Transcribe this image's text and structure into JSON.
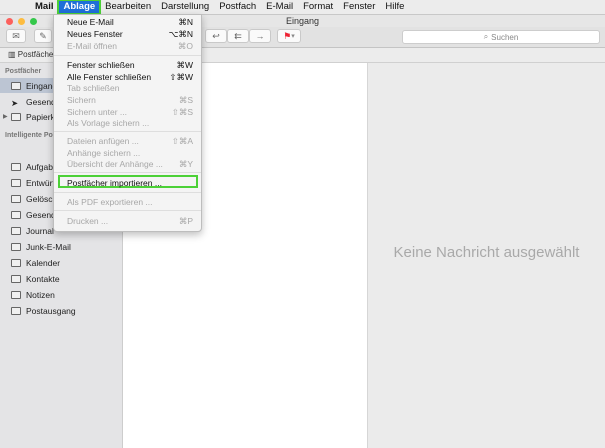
{
  "menubar": {
    "app": "Mail",
    "menus": [
      "Ablage",
      "Bearbeiten",
      "Darstellung",
      "Postfach",
      "E-Mail",
      "Format",
      "Fenster",
      "Hilfe"
    ]
  },
  "window": {
    "title": "Eingang"
  },
  "toolbar": {
    "search_placeholder": "Suchen"
  },
  "favorites": {
    "postfacher": "Postfächer"
  },
  "sidebar": {
    "section_mailboxes": "Postfächer",
    "mailboxes": [
      "Eingang",
      "Gesendet",
      "Papierkorb"
    ],
    "section_smart": "Intelligente Po",
    "folders": [
      "Aufgaben",
      "Entwürfe",
      "Gelöscht",
      "Gesendet",
      "Journal",
      "Junk-E-Mail",
      "Kalender",
      "Kontakte",
      "Notizen",
      "Postausgang"
    ]
  },
  "message_area": {
    "empty_text": "Keine Nachricht ausgewählt"
  },
  "ablage_menu": {
    "items": [
      {
        "label": "Neue E-Mail",
        "shortcut": "⌘N"
      },
      {
        "label": "Neues Fenster",
        "shortcut": "⌥⌘N"
      },
      {
        "label": "E-Mail öffnen",
        "shortcut": "⌘O"
      },
      {
        "label": "Fenster schließen",
        "shortcut": "⌘W"
      },
      {
        "label": "Alle Fenster schließen",
        "shortcut": "⇧⌘W"
      },
      {
        "label": "Tab schließen",
        "shortcut": ""
      },
      {
        "label": "Sichern",
        "shortcut": "⌘S"
      },
      {
        "label": "Sichern unter ...",
        "shortcut": "⇧⌘S"
      },
      {
        "label": "Als Vorlage sichern ...",
        "shortcut": ""
      },
      {
        "label": "Dateien anfügen ...",
        "shortcut": "⇧⌘A"
      },
      {
        "label": "Anhänge sichern ...",
        "shortcut": ""
      },
      {
        "label": "Übersicht der Anhänge ...",
        "shortcut": "⌘Y"
      },
      {
        "label": "Postfächer importieren ...",
        "shortcut": ""
      },
      {
        "label": "Als PDF exportieren ...",
        "shortcut": ""
      },
      {
        "label": "Drucken ...",
        "shortcut": "⌘P"
      }
    ]
  },
  "colors": {
    "highlight_green": "#4cd137",
    "menu_selected_blue": "#1f6fd8"
  }
}
